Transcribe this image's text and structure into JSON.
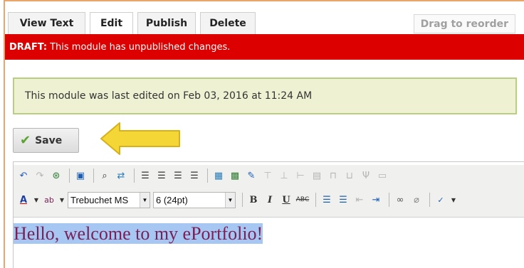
{
  "tabs": [
    {
      "label": "View Text"
    },
    {
      "label": "Edit"
    },
    {
      "label": "Publish"
    },
    {
      "label": "Delete"
    }
  ],
  "drag_label": "Drag to reorder",
  "draft": {
    "strong": "DRAFT:",
    "text": "This module has unpublished changes."
  },
  "notice": "This module was last edited on Feb 03, 2016 at 11:24 AM",
  "save_label": "Save",
  "toolbar": {
    "font_family": "Trebuchet MS",
    "font_size": "6 (24pt)",
    "buttons_row1": [
      "undo-icon",
      "redo-icon",
      "cleanup-icon",
      "paste-word-icon",
      "find-icon",
      "replace-icon",
      "align-left-icon",
      "align-center-icon",
      "align-right-icon",
      "align-justify-icon",
      "insert-table-icon",
      "insert-image-icon",
      "edit-icon",
      "table-row-before-icon",
      "table-row-after-icon",
      "table-col-before-icon",
      "table-col-after-icon",
      "merge-cells-icon",
      "split-cells-icon",
      "delete-table-icon"
    ],
    "buttons_row2": [
      "font-color-icon",
      "highlight-icon",
      "bold-icon",
      "italic-icon",
      "underline-icon",
      "strikethrough-icon",
      "bullet-list-icon",
      "numbered-list-icon",
      "outdent-icon",
      "indent-icon",
      "link-icon",
      "unlink-icon",
      "spellcheck-icon"
    ]
  },
  "content_text": "Hello, welcome to my ePortfolio!",
  "colors": {
    "draft_bg": "#dc0000",
    "notice_bg": "#eef2d2",
    "notice_border": "#b8cf81",
    "arrow": "#f5d637",
    "text_purple": "#7a2057"
  }
}
